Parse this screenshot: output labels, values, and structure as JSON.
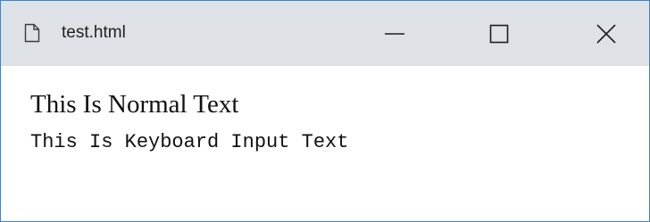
{
  "window": {
    "title": "test.html",
    "title_icon": "document-icon",
    "controls": {
      "minimize_icon": "minimize-icon",
      "maximize_icon": "maximize-icon",
      "close_icon": "close-icon"
    },
    "colors": {
      "titlebar": "#dee1e6",
      "border": "#3c86c9",
      "content": "#ffffff"
    }
  },
  "page": {
    "normal_text": "This Is Normal Text",
    "keyboard_text": "This Is Keyboard Input Text"
  }
}
